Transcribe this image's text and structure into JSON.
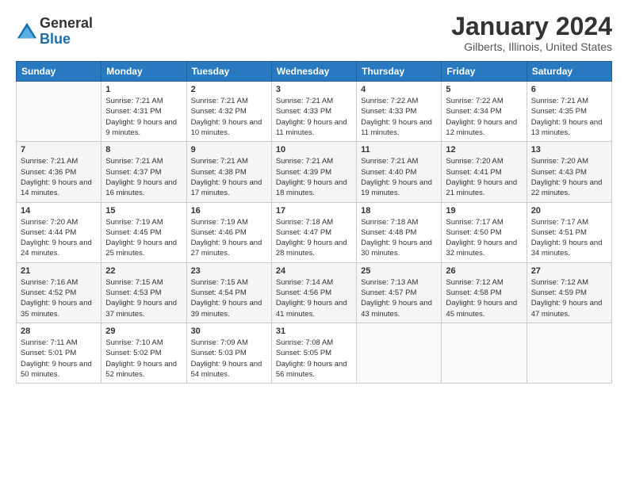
{
  "logo": {
    "general": "General",
    "blue": "Blue"
  },
  "title": "January 2024",
  "subtitle": "Gilberts, Illinois, United States",
  "weekdays": [
    "Sunday",
    "Monday",
    "Tuesday",
    "Wednesday",
    "Thursday",
    "Friday",
    "Saturday"
  ],
  "weeks": [
    [
      {
        "day": "",
        "sunrise": "",
        "sunset": "",
        "daylight": ""
      },
      {
        "day": "1",
        "sunrise": "Sunrise: 7:21 AM",
        "sunset": "Sunset: 4:31 PM",
        "daylight": "Daylight: 9 hours and 9 minutes."
      },
      {
        "day": "2",
        "sunrise": "Sunrise: 7:21 AM",
        "sunset": "Sunset: 4:32 PM",
        "daylight": "Daylight: 9 hours and 10 minutes."
      },
      {
        "day": "3",
        "sunrise": "Sunrise: 7:21 AM",
        "sunset": "Sunset: 4:33 PM",
        "daylight": "Daylight: 9 hours and 11 minutes."
      },
      {
        "day": "4",
        "sunrise": "Sunrise: 7:22 AM",
        "sunset": "Sunset: 4:33 PM",
        "daylight": "Daylight: 9 hours and 11 minutes."
      },
      {
        "day": "5",
        "sunrise": "Sunrise: 7:22 AM",
        "sunset": "Sunset: 4:34 PM",
        "daylight": "Daylight: 9 hours and 12 minutes."
      },
      {
        "day": "6",
        "sunrise": "Sunrise: 7:21 AM",
        "sunset": "Sunset: 4:35 PM",
        "daylight": "Daylight: 9 hours and 13 minutes."
      }
    ],
    [
      {
        "day": "7",
        "sunrise": "Sunrise: 7:21 AM",
        "sunset": "Sunset: 4:36 PM",
        "daylight": "Daylight: 9 hours and 14 minutes."
      },
      {
        "day": "8",
        "sunrise": "Sunrise: 7:21 AM",
        "sunset": "Sunset: 4:37 PM",
        "daylight": "Daylight: 9 hours and 16 minutes."
      },
      {
        "day": "9",
        "sunrise": "Sunrise: 7:21 AM",
        "sunset": "Sunset: 4:38 PM",
        "daylight": "Daylight: 9 hours and 17 minutes."
      },
      {
        "day": "10",
        "sunrise": "Sunrise: 7:21 AM",
        "sunset": "Sunset: 4:39 PM",
        "daylight": "Daylight: 9 hours and 18 minutes."
      },
      {
        "day": "11",
        "sunrise": "Sunrise: 7:21 AM",
        "sunset": "Sunset: 4:40 PM",
        "daylight": "Daylight: 9 hours and 19 minutes."
      },
      {
        "day": "12",
        "sunrise": "Sunrise: 7:20 AM",
        "sunset": "Sunset: 4:41 PM",
        "daylight": "Daylight: 9 hours and 21 minutes."
      },
      {
        "day": "13",
        "sunrise": "Sunrise: 7:20 AM",
        "sunset": "Sunset: 4:43 PM",
        "daylight": "Daylight: 9 hours and 22 minutes."
      }
    ],
    [
      {
        "day": "14",
        "sunrise": "Sunrise: 7:20 AM",
        "sunset": "Sunset: 4:44 PM",
        "daylight": "Daylight: 9 hours and 24 minutes."
      },
      {
        "day": "15",
        "sunrise": "Sunrise: 7:19 AM",
        "sunset": "Sunset: 4:45 PM",
        "daylight": "Daylight: 9 hours and 25 minutes."
      },
      {
        "day": "16",
        "sunrise": "Sunrise: 7:19 AM",
        "sunset": "Sunset: 4:46 PM",
        "daylight": "Daylight: 9 hours and 27 minutes."
      },
      {
        "day": "17",
        "sunrise": "Sunrise: 7:18 AM",
        "sunset": "Sunset: 4:47 PM",
        "daylight": "Daylight: 9 hours and 28 minutes."
      },
      {
        "day": "18",
        "sunrise": "Sunrise: 7:18 AM",
        "sunset": "Sunset: 4:48 PM",
        "daylight": "Daylight: 9 hours and 30 minutes."
      },
      {
        "day": "19",
        "sunrise": "Sunrise: 7:17 AM",
        "sunset": "Sunset: 4:50 PM",
        "daylight": "Daylight: 9 hours and 32 minutes."
      },
      {
        "day": "20",
        "sunrise": "Sunrise: 7:17 AM",
        "sunset": "Sunset: 4:51 PM",
        "daylight": "Daylight: 9 hours and 34 minutes."
      }
    ],
    [
      {
        "day": "21",
        "sunrise": "Sunrise: 7:16 AM",
        "sunset": "Sunset: 4:52 PM",
        "daylight": "Daylight: 9 hours and 35 minutes."
      },
      {
        "day": "22",
        "sunrise": "Sunrise: 7:15 AM",
        "sunset": "Sunset: 4:53 PM",
        "daylight": "Daylight: 9 hours and 37 minutes."
      },
      {
        "day": "23",
        "sunrise": "Sunrise: 7:15 AM",
        "sunset": "Sunset: 4:54 PM",
        "daylight": "Daylight: 9 hours and 39 minutes."
      },
      {
        "day": "24",
        "sunrise": "Sunrise: 7:14 AM",
        "sunset": "Sunset: 4:56 PM",
        "daylight": "Daylight: 9 hours and 41 minutes."
      },
      {
        "day": "25",
        "sunrise": "Sunrise: 7:13 AM",
        "sunset": "Sunset: 4:57 PM",
        "daylight": "Daylight: 9 hours and 43 minutes."
      },
      {
        "day": "26",
        "sunrise": "Sunrise: 7:12 AM",
        "sunset": "Sunset: 4:58 PM",
        "daylight": "Daylight: 9 hours and 45 minutes."
      },
      {
        "day": "27",
        "sunrise": "Sunrise: 7:12 AM",
        "sunset": "Sunset: 4:59 PM",
        "daylight": "Daylight: 9 hours and 47 minutes."
      }
    ],
    [
      {
        "day": "28",
        "sunrise": "Sunrise: 7:11 AM",
        "sunset": "Sunset: 5:01 PM",
        "daylight": "Daylight: 9 hours and 50 minutes."
      },
      {
        "day": "29",
        "sunrise": "Sunrise: 7:10 AM",
        "sunset": "Sunset: 5:02 PM",
        "daylight": "Daylight: 9 hours and 52 minutes."
      },
      {
        "day": "30",
        "sunrise": "Sunrise: 7:09 AM",
        "sunset": "Sunset: 5:03 PM",
        "daylight": "Daylight: 9 hours and 54 minutes."
      },
      {
        "day": "31",
        "sunrise": "Sunrise: 7:08 AM",
        "sunset": "Sunset: 5:05 PM",
        "daylight": "Daylight: 9 hours and 56 minutes."
      },
      {
        "day": "",
        "sunrise": "",
        "sunset": "",
        "daylight": ""
      },
      {
        "day": "",
        "sunrise": "",
        "sunset": "",
        "daylight": ""
      },
      {
        "day": "",
        "sunrise": "",
        "sunset": "",
        "daylight": ""
      }
    ]
  ]
}
